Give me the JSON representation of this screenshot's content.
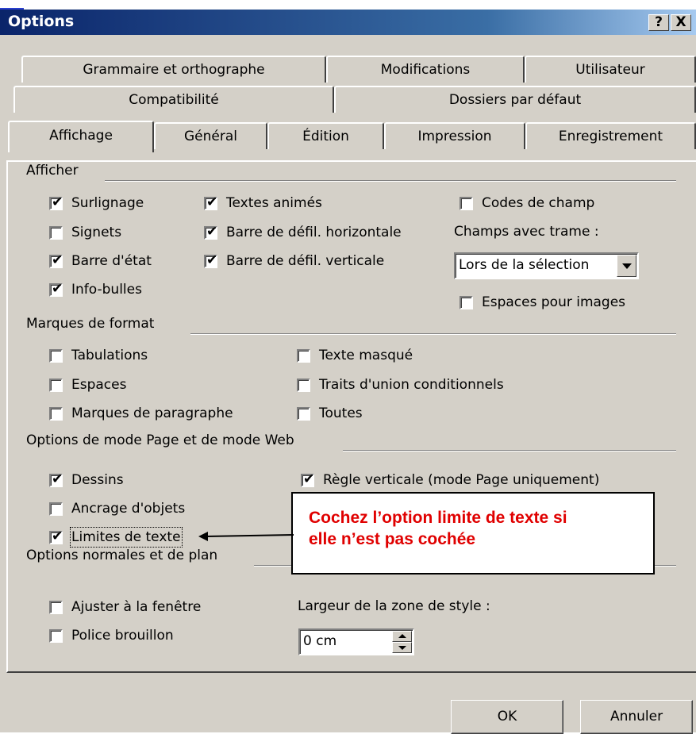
{
  "window": {
    "title": "Options",
    "help_button": "?",
    "close_button": "X"
  },
  "tabs": {
    "row1": [
      "Grammaire et orthographe",
      "Modifications",
      "Utilisateur"
    ],
    "row2": [
      "Compatibilité",
      "Dossiers par défaut"
    ],
    "row3": [
      "Affichage",
      "Général",
      "Édition",
      "Impression",
      "Enregistrement"
    ],
    "active": "Affichage"
  },
  "afficher": {
    "label": "Afficher",
    "surlignage": {
      "label": "Surlignage",
      "checked": true
    },
    "signets": {
      "label": "Signets",
      "checked": false
    },
    "barre_etat": {
      "label": "Barre d'état",
      "checked": true
    },
    "info_bulles": {
      "label": "Info-bulles",
      "checked": true
    },
    "textes_animes": {
      "label": "Textes animés",
      "checked": true
    },
    "defil_horizontale": {
      "label": "Barre de défil. horizontale",
      "checked": true
    },
    "defil_verticale": {
      "label": "Barre de défil. verticale",
      "checked": true
    },
    "codes_champ": {
      "label": "Codes de champ",
      "checked": false
    },
    "champs_trame_label": "Champs avec trame :",
    "champs_trame_value": "Lors de la sélection",
    "espaces_images": {
      "label": "Espaces pour images",
      "checked": false
    }
  },
  "marques": {
    "label": "Marques de format",
    "tabulations": {
      "label": "Tabulations",
      "checked": false
    },
    "espaces": {
      "label": "Espaces",
      "checked": false
    },
    "paragraphe": {
      "label": "Marques de paragraphe",
      "checked": false
    },
    "texte_masque": {
      "label": "Texte masqué",
      "checked": false
    },
    "traits_union": {
      "label": "Traits d'union conditionnels",
      "checked": false
    },
    "toutes": {
      "label": "Toutes",
      "checked": false
    }
  },
  "mode_page": {
    "label": "Options de mode Page et de mode Web",
    "dessins": {
      "label": "Dessins",
      "checked": true
    },
    "ancrage": {
      "label": "Ancrage d'objets",
      "checked": false
    },
    "limites": {
      "label": "Limites de texte",
      "checked": true
    },
    "regle": {
      "label": "Règle verticale (mode Page uniquement)",
      "checked": true
    }
  },
  "normales": {
    "label": "Options normales et de plan",
    "ajuster": {
      "label": "Ajuster à la fenêtre",
      "checked": false
    },
    "police": {
      "label": "Police brouillon",
      "checked": false
    },
    "largeur_label": "Largeur de la zone de style :",
    "largeur_value": "0 cm"
  },
  "callout": {
    "line1": "Cochez l’option limite de texte si",
    "line2": "elle n’est pas cochée",
    "color": "#e00000"
  },
  "buttons": {
    "ok": "OK",
    "cancel": "Annuler"
  },
  "check_glyph": "✔"
}
